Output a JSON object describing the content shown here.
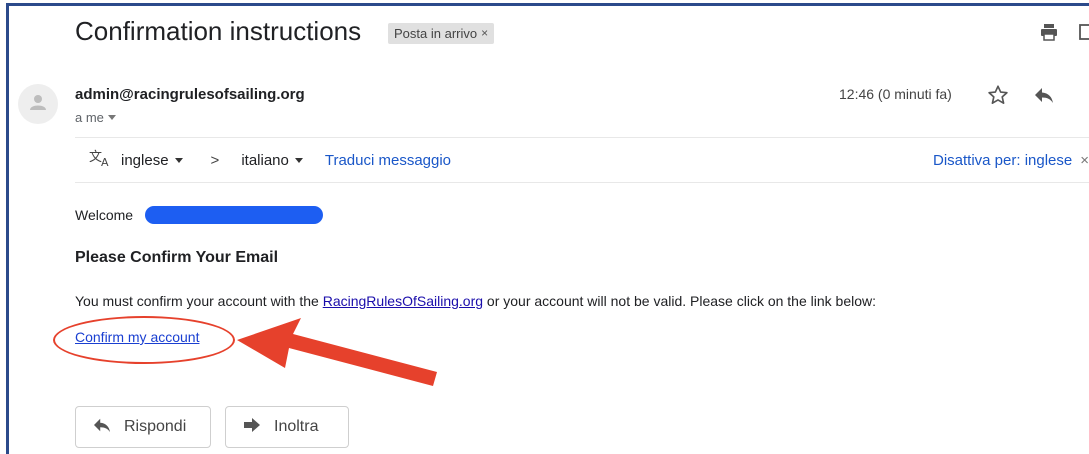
{
  "email": {
    "subject": "Confirmation instructions",
    "label": "Posta in arrivo",
    "label_close": "×",
    "sender": "admin@racingrulesofsailing.org",
    "recipient": "a me",
    "time": "12:46 (0 minuti fa)"
  },
  "translate": {
    "from_lang": "inglese",
    "arrow": ">",
    "to_lang": "italiano",
    "translate_link": "Traduci messaggio",
    "disable_link": "Disattiva per: inglese",
    "close": "×"
  },
  "body": {
    "welcome": "Welcome",
    "heading": "Please Confirm Your Email",
    "paragraph_pre": "You must confirm your account with the ",
    "paragraph_link": "RacingRulesOfSailing.org",
    "paragraph_post": " or your account will not be valid. Please click on the link below:",
    "confirm_link": "Confirm my account"
  },
  "actions": {
    "reply": "Rispondi",
    "forward": "Inoltra"
  },
  "colors": {
    "annotation": "#e6412c",
    "redaction": "#1d5ef2",
    "link": "#1a57c8",
    "frame": "#2b4a8b"
  },
  "icons": [
    "print-icon",
    "open-in-new-icon",
    "avatar-person-icon",
    "star-icon",
    "reply-icon",
    "translate-icon",
    "forward-icon",
    "annotation-arrow"
  ]
}
